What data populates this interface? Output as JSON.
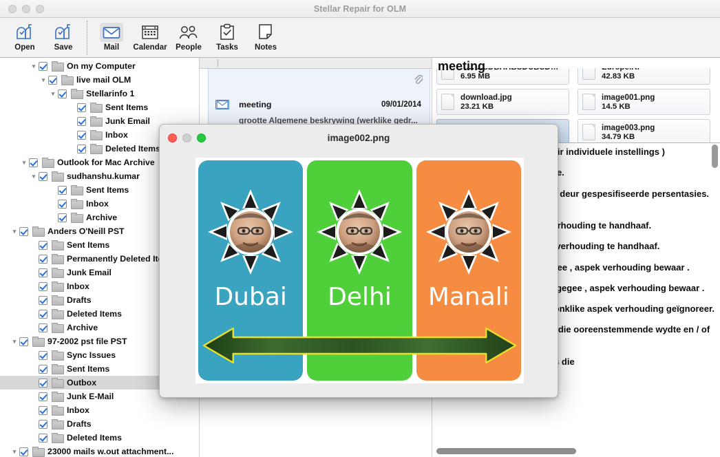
{
  "window": {
    "title": "Stellar Repair for OLM",
    "traffic_lights": [
      "close-disabled",
      "minimize-disabled",
      "zoom-disabled"
    ]
  },
  "toolbar": {
    "items": [
      {
        "label": "Open",
        "icon": "mailbox-open-icon",
        "selected": false
      },
      {
        "label": "Save",
        "icon": "mailbox-save-icon",
        "selected": false
      },
      {
        "label": "Mail",
        "icon": "envelope-icon",
        "selected": true
      },
      {
        "label": "Calendar",
        "icon": "calendar-icon",
        "selected": false
      },
      {
        "label": "People",
        "icon": "people-icon",
        "selected": false
      },
      {
        "label": "Tasks",
        "icon": "clipboard-check-icon",
        "selected": false
      },
      {
        "label": "Notes",
        "icon": "note-page-icon",
        "selected": false
      }
    ]
  },
  "sidebar": {
    "items": [
      {
        "label": "On my Computer",
        "indent": 3,
        "disclosure": "down",
        "checked": true,
        "selected": false
      },
      {
        "label": "live mail OLM",
        "indent": 4,
        "disclosure": "down",
        "checked": true,
        "selected": false
      },
      {
        "label": "Stellarinfo 1",
        "indent": 5,
        "disclosure": "down",
        "checked": true,
        "selected": false
      },
      {
        "label": "Sent Items",
        "indent": 7,
        "disclosure": "",
        "checked": true,
        "selected": false
      },
      {
        "label": "Junk Email",
        "indent": 7,
        "disclosure": "",
        "checked": true,
        "selected": false
      },
      {
        "label": "Inbox",
        "indent": 7,
        "disclosure": "",
        "checked": true,
        "selected": false
      },
      {
        "label": "Deleted Items",
        "indent": 7,
        "disclosure": "",
        "checked": true,
        "selected": false
      },
      {
        "label": "Outlook for Mac Archive",
        "indent": 2,
        "disclosure": "down",
        "checked": true,
        "selected": false
      },
      {
        "label": "sudhanshu.kumar",
        "indent": 3,
        "disclosure": "down",
        "checked": true,
        "selected": false
      },
      {
        "label": "Sent Items",
        "indent": 5,
        "disclosure": "",
        "checked": true,
        "selected": false
      },
      {
        "label": "Inbox",
        "indent": 5,
        "disclosure": "",
        "checked": true,
        "selected": false
      },
      {
        "label": "Archive",
        "indent": 5,
        "disclosure": "",
        "checked": true,
        "selected": false
      },
      {
        "label": "Anders O'Neill PST",
        "indent": 1,
        "disclosure": "down",
        "checked": true,
        "selected": false
      },
      {
        "label": "Sent Items",
        "indent": 3,
        "disclosure": "",
        "checked": true,
        "selected": false
      },
      {
        "label": "Permanently Deleted Items",
        "indent": 3,
        "disclosure": "",
        "checked": true,
        "selected": false
      },
      {
        "label": "Junk Email",
        "indent": 3,
        "disclosure": "",
        "checked": true,
        "selected": false
      },
      {
        "label": "Inbox",
        "indent": 3,
        "disclosure": "",
        "checked": true,
        "selected": false
      },
      {
        "label": "Drafts",
        "indent": 3,
        "disclosure": "",
        "checked": true,
        "selected": false
      },
      {
        "label": "Deleted Items",
        "indent": 3,
        "disclosure": "",
        "checked": true,
        "selected": false
      },
      {
        "label": "Archive",
        "indent": 3,
        "disclosure": "",
        "checked": true,
        "selected": false
      },
      {
        "label": "97-2002 pst file PST",
        "indent": 1,
        "disclosure": "down",
        "checked": true,
        "selected": false
      },
      {
        "label": "Sync Issues",
        "indent": 3,
        "disclosure": "",
        "checked": true,
        "selected": false
      },
      {
        "label": "Sent Items",
        "indent": 3,
        "disclosure": "",
        "checked": true,
        "selected": false
      },
      {
        "label": "Outbox",
        "indent": 3,
        "disclosure": "",
        "checked": true,
        "selected": true
      },
      {
        "label": "Junk E-Mail",
        "indent": 3,
        "disclosure": "",
        "checked": true,
        "selected": false
      },
      {
        "label": "Inbox",
        "indent": 3,
        "disclosure": "",
        "checked": true,
        "selected": false
      },
      {
        "label": "Drafts",
        "indent": 3,
        "disclosure": "",
        "checked": true,
        "selected": false
      },
      {
        "label": "Deleted Items",
        "indent": 3,
        "disclosure": "",
        "checked": true,
        "selected": false
      },
      {
        "label": "23000 mails w.out attachment...",
        "indent": 1,
        "disclosure": "down",
        "checked": true,
        "selected": false
      }
    ]
  },
  "message_list": {
    "messages": [
      {
        "subject": "meeting",
        "date": "09/01/2014",
        "preview": "grootte Algemene beskrywing (werklike gedr...",
        "has_attachment": true,
        "attachment_icon": "paperclip-icon",
        "envelope_icon": "envelope-icon",
        "selected": true
      }
    ]
  },
  "reading_pane": {
    "subject": "meeting",
    "attachments": [
      {
        "name": "HDFBSDBHHBSDCBSDHH...",
        "size": "6.95 MB",
        "selected": false,
        "clipped_top": true
      },
      {
        "name": "Europe.rtf",
        "size": "42.83 KB",
        "selected": false,
        "clipped_top": true
      },
      {
        "name": "download.jpg",
        "size": "23.21 KB",
        "selected": false,
        "clipped_top": false
      },
      {
        "name": "image001.png",
        "size": "14.5  KB",
        "selected": false,
        "clipped_top": false
      },
      {
        "name": "image002.png",
        "size": "",
        "selected": true,
        "clipped_top": false
      },
      {
        "name": "image003.png",
        "size": "34.79 KB",
        "selected": false,
        "clipped_top": false
      }
    ],
    "body_paragraphs": [
      "grootte Algemene beskrywing (werklike gedrag kan wissel vir individuele instellings )",
      "scale% Hoogte en breedte afgeskaal deur sekere persentasie.",
      "scale-x%xscale-y% Hoogte en breedte individueel afgeskaal deur gespesifiseerde persentasies. (Slegs een % simbool nodig . )",
      "width Breedte gegee, hoogte automagically gekies aspek verhouding te handhaaf.",
      "xheight Hoogte gegee, breedte automagically gekies aspek verhouding te handhaaf.",
      "widthxheight Maksimum waardes van lengte en breedte gegee , aspek verhouding bewaar .",
      "widthxheight! Minimum waardes van die hoogte en breedte gegee , aspek verhouding bewaar .",
      "widthxheight^ Wydte en hoogte ten sterkste gegee , oorspronklike aspek verhouding geïgnoreer.",
      "widthxheight > Krimp 'n beeld met dimensie (s ) groter is as die ooreenstemmende wydte en / of hoogte argument (s).",
      "widthxheight < vergroot 'n beeld met dimensie (s ) kleiner as die"
    ]
  },
  "image_dialog": {
    "title": "image002.png",
    "traffic_lights": {
      "close": "close-red",
      "minimize": "minimize-gray",
      "zoom": "zoom-green"
    },
    "image": {
      "panels": [
        {
          "city": "Dubai",
          "color": "#3aa3c0"
        },
        {
          "city": "Delhi",
          "color": "#4fd03a"
        },
        {
          "city": "Manali",
          "color": "#f58c42"
        }
      ],
      "badge": "sun-face-badge",
      "arrow": "double-headed-arrow"
    }
  },
  "colors": {
    "dubai": "#3aa3c0",
    "delhi": "#4fd03a",
    "manali": "#f58c42",
    "selection_blue": "#cfdcf0",
    "sidebar_selected": "#d8d8d8",
    "checkbox_check": "#2b6fd4"
  }
}
